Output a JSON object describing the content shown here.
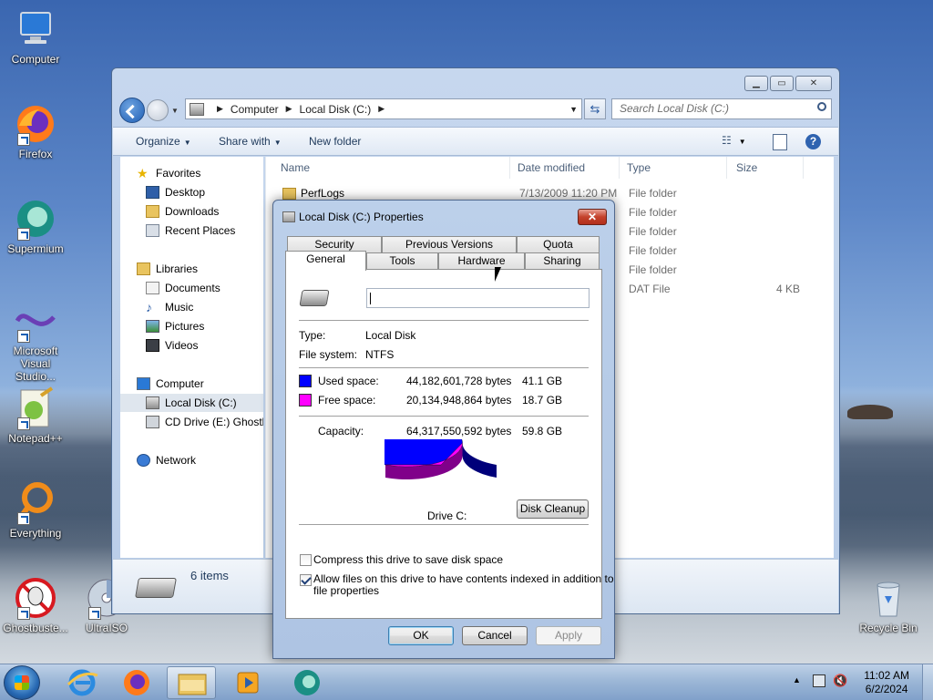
{
  "desktop": {
    "icons": [
      {
        "label": "Computer"
      },
      {
        "label": "Firefox"
      },
      {
        "label": "Supermium"
      },
      {
        "label": "Microsoft Visual Studio..."
      },
      {
        "label": "Notepad++"
      },
      {
        "label": "Everything"
      },
      {
        "label": "Ghostbuste..."
      },
      {
        "label": "UltraISO"
      },
      {
        "label": "Recycle Bin"
      }
    ]
  },
  "explorer": {
    "breadcrumb": [
      "Computer",
      "Local Disk (C:)"
    ],
    "search_placeholder": "Search Local Disk (C:)",
    "toolbar": {
      "organize": "Organize",
      "share_with": "Share with",
      "new_folder": "New folder"
    },
    "nav": {
      "favorites": "Favorites",
      "favorites_items": [
        "Desktop",
        "Downloads",
        "Recent Places"
      ],
      "libraries": "Libraries",
      "libraries_items": [
        "Documents",
        "Music",
        "Pictures",
        "Videos"
      ],
      "computer": "Computer",
      "computer_items": [
        "Local Disk (C:)",
        "CD Drive (E:) Ghostb"
      ],
      "network": "Network"
    },
    "columns": [
      "Name",
      "Date modified",
      "Type",
      "Size"
    ],
    "rows": [
      {
        "name": "PerfLogs",
        "date": "7/13/2009 11:20 PM",
        "type": "File folder",
        "size": ""
      },
      {
        "name": "",
        "date": "",
        "type": "File folder",
        "size": ""
      },
      {
        "name": "",
        "date": "",
        "type": "File folder",
        "size": ""
      },
      {
        "name": "",
        "date": "",
        "type": "File folder",
        "size": ""
      },
      {
        "name": "",
        "date": "",
        "type": "File folder",
        "size": ""
      },
      {
        "name": "",
        "date": "",
        "type": "DAT File",
        "size": "4 KB"
      }
    ],
    "status_items": "6 items"
  },
  "dialog": {
    "title": "Local Disk (C:) Properties",
    "tabs_row1": [
      "Security",
      "Previous Versions",
      "Quota"
    ],
    "tabs_row2": [
      "General",
      "Tools",
      "Hardware",
      "Sharing"
    ],
    "active_tab": "General",
    "name_value": "",
    "type_label": "Type:",
    "type_value": "Local Disk",
    "fs_label": "File system:",
    "fs_value": "NTFS",
    "used_label": "Used space:",
    "used_bytes": "44,182,601,728 bytes",
    "used_gb": "41.1 GB",
    "free_label": "Free space:",
    "free_bytes": "20,134,948,864 bytes",
    "free_gb": "18.7 GB",
    "capacity_label": "Capacity:",
    "capacity_bytes": "64,317,550,592 bytes",
    "capacity_gb": "59.8 GB",
    "drive_label": "Drive C:",
    "disk_cleanup": "Disk Cleanup",
    "used_fraction": 0.687,
    "colors": {
      "used": "#0000ff",
      "free": "#ff00ff"
    },
    "compress_label": "Compress this drive to save disk space",
    "compress_checked": false,
    "index_label_1": "Allow files on this drive to have contents indexed in addition to",
    "index_label_2": "file properties",
    "index_checked": true,
    "ok": "OK",
    "cancel": "Cancel",
    "apply": "Apply"
  },
  "taskbar": {
    "time": "11:02 AM",
    "date": "6/2/2024"
  }
}
